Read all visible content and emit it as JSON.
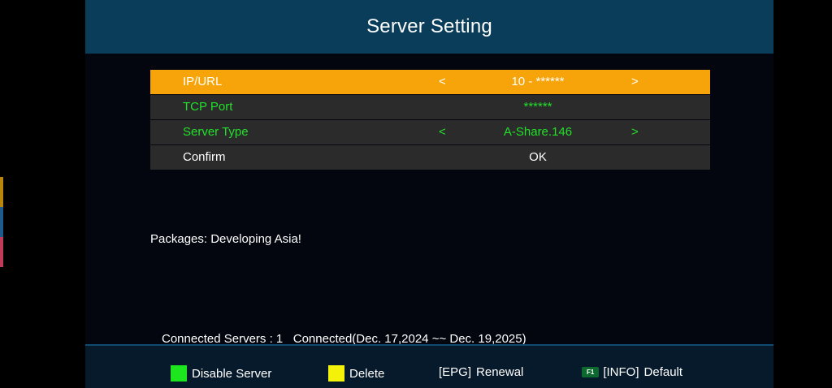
{
  "colors": {
    "header_bg": "#0a3d5a",
    "selected_row": "#f6a40a",
    "row_bg": "#2b2b2b",
    "accent_green": "#22e02a",
    "key_green": "#1ee61e",
    "key_yellow": "#f5f20a",
    "strip": [
      "#b8860b",
      "#1e5a8a",
      "#c03a5a"
    ]
  },
  "header": {
    "title": "Server Setting"
  },
  "menu": [
    {
      "label": "IP/URL",
      "left_arrow": "<",
      "value": "10 - ******",
      "right_arrow": ">",
      "selected": true
    },
    {
      "label": "TCP Port",
      "value": "******",
      "selected": false
    },
    {
      "label": "Server Type",
      "left_arrow": "<",
      "value": "A-Share.146",
      "right_arrow": ">",
      "selected": false
    },
    {
      "label": "Confirm",
      "value": "OK",
      "selected": false
    }
  ],
  "packages_text": "Packages: Developing Asia!",
  "connected_text": "Connected Servers : 1   Connected(Dec. 17,2024 ~~ Dec. 19,2025)",
  "footer": {
    "disable_server": {
      "icon": "green-key-icon",
      "label": "Disable Server"
    },
    "delete": {
      "icon": "yellow-key-icon",
      "label": "Delete"
    },
    "renewal": {
      "key": "[EPG]",
      "label": "Renewal"
    },
    "default": {
      "badge": "F1",
      "key": "[INFO]",
      "label": "Default"
    }
  }
}
